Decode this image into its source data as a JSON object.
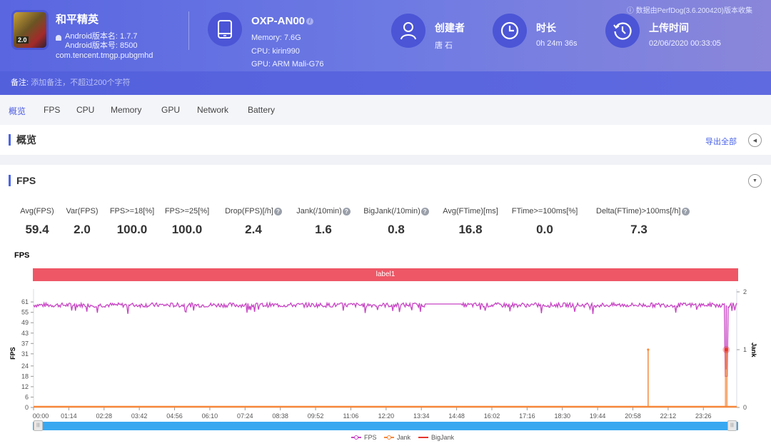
{
  "header": {
    "app": {
      "name": "和平精英",
      "version_name": "Android版本名: 1.7.7",
      "version_code": "Android版本号: 8500",
      "package": "com.tencent.tmgp.pubgmhd",
      "icon_badge": "2.0",
      "platform_icon": "android-icon"
    },
    "device": {
      "model": "OXP-AN00",
      "memory": "Memory: 7.6G",
      "cpu": "CPU: kirin990",
      "gpu": "GPU: ARM Mali-G76",
      "icon": "tablet-icon",
      "info_glyph": "i"
    },
    "creator": {
      "title": "创建者",
      "value": "唐 石",
      "icon": "user-icon"
    },
    "duration": {
      "title": "时长",
      "value": "0h 24m 36s",
      "icon": "clock-icon"
    },
    "upload": {
      "title": "上传时间",
      "value": "02/06/2020 00:33:05",
      "icon": "history-icon"
    },
    "collect_note": "ⓘ 数据由PerfDog(3.6.200420)版本收集"
  },
  "notes": {
    "label": "备注:",
    "placeholder": "添加备注，不超过200个字符"
  },
  "tabs": [
    {
      "label": "概览",
      "active": true
    },
    {
      "label": "FPS",
      "active": false
    },
    {
      "label": "CPU",
      "active": false
    },
    {
      "label": "Memory",
      "active": false
    },
    {
      "label": "GPU",
      "active": false
    },
    {
      "label": "Network",
      "active": false
    },
    {
      "label": "Battery",
      "active": false
    }
  ],
  "overview": {
    "title": "概览",
    "export_label": "导出全部",
    "toggle_glyph": "◀"
  },
  "fps_section": {
    "title": "FPS",
    "toggle_glyph": "▼",
    "help_glyph": "?",
    "metrics": [
      {
        "label": "Avg(FPS)",
        "value": "59.4",
        "help": false
      },
      {
        "label": "Var(FPS)",
        "value": "2.0",
        "help": false
      },
      {
        "label": "FPS>=18[%]",
        "value": "100.0",
        "help": false
      },
      {
        "label": "FPS>=25[%]",
        "value": "100.0",
        "help": false
      },
      {
        "label": "Drop(FPS)[/h]",
        "value": "2.4",
        "help": true
      },
      {
        "label": "Jank(/10min)",
        "value": "1.6",
        "help": true
      },
      {
        "label": "BigJank(/10min)",
        "value": "0.8",
        "help": true
      },
      {
        "label": "Avg(FTime)[ms]",
        "value": "16.8",
        "help": false
      },
      {
        "label": "FTime>=100ms[%]",
        "value": "0.0",
        "help": false
      },
      {
        "label": "Delta(FTime)>100ms[/h]",
        "value": "7.3",
        "help": true
      }
    ]
  },
  "chart_data": {
    "type": "line",
    "title": "FPS",
    "label_band": "label1",
    "xlabel": "",
    "ylabel": "FPS",
    "y2label": "Jank",
    "ylim": [
      0,
      66
    ],
    "y_ticks": [
      0,
      6,
      12,
      18,
      24,
      31,
      37,
      43,
      49,
      55,
      61
    ],
    "y2lim": [
      0,
      2
    ],
    "y2_ticks": [
      0,
      1,
      2
    ],
    "x_ticks": [
      "00:00",
      "01:14",
      "02:28",
      "03:42",
      "04:56",
      "06:10",
      "07:24",
      "08:38",
      "09:52",
      "11:06",
      "12:20",
      "13:34",
      "14:48",
      "16:02",
      "17:16",
      "18:30",
      "19:44",
      "20:58",
      "22:12",
      "23:26"
    ],
    "x_range_seconds": [
      0,
      1476
    ],
    "grid": false,
    "legend_position": "bottom-center",
    "series": [
      {
        "name": "FPS",
        "axis": "left",
        "color": "#c744c4",
        "typical_value": 59.4,
        "min_dip_value": 53,
        "end_drop_value": 8,
        "end_time_s": 1454
      },
      {
        "name": "Jank",
        "axis": "right",
        "color": "#f7883a",
        "spikes": [
          {
            "t_s": 1290,
            "value": 1
          },
          {
            "t_s": 1454,
            "value": 1
          }
        ],
        "baseline": 0
      },
      {
        "name": "BigJank",
        "axis": "right",
        "color": "#e8352c",
        "spikes": [
          {
            "t_s": 1454,
            "value": 1
          }
        ],
        "baseline": 0
      }
    ]
  },
  "scrollbar": {
    "start": 0.0,
    "end": 1.0
  }
}
